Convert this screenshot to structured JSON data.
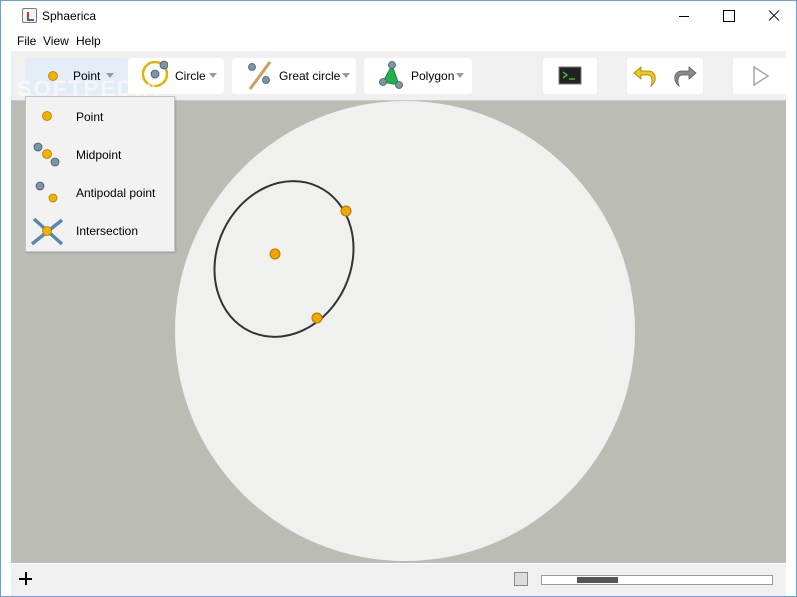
{
  "window": {
    "title": "Sphaerica"
  },
  "menu": [
    "File",
    "View",
    "Help"
  ],
  "toolbar": {
    "point_label": "Point",
    "circle_label": "Circle",
    "great_circle_label": "Great circle",
    "polygon_label": "Polygon",
    "console_icon": "terminal-icon",
    "undo_icon": "undo-arrow-icon",
    "redo_icon": "redo-arrow-icon",
    "run_icon": "play-icon"
  },
  "point_menu": {
    "items": [
      {
        "label": "Point",
        "icon": "point-icon"
      },
      {
        "label": "Midpoint",
        "icon": "midpoint-icon"
      },
      {
        "label": "Antipodal point",
        "icon": "antipodal-point-icon"
      },
      {
        "label": "Intersection",
        "icon": "intersection-icon"
      }
    ]
  },
  "colors": {
    "point_fill": "#f2b300",
    "sphere_fill": "#f0f0ef",
    "canvas_bg": "#bbbcb4",
    "curve_stroke": "#333333",
    "active_tool_bg": "#e4ecf6"
  },
  "statusbar": {
    "add_icon": "plus-icon",
    "settings_icon": "wrench-icon"
  },
  "watermark": "SOFTPEDIA"
}
